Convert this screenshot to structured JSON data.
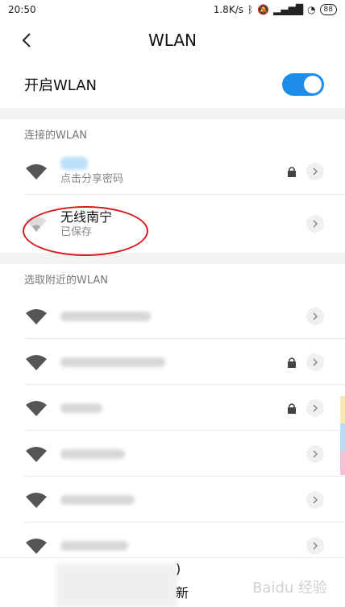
{
  "status": {
    "time": "20:50",
    "speed": "1.8K/s",
    "battery": "88"
  },
  "header": {
    "title": "WLAN"
  },
  "wlan_toggle": {
    "label": "开启WLAN",
    "enabled": true
  },
  "connected_section": {
    "title": "连接的WLAN"
  },
  "connected_networks": [
    {
      "name": "",
      "sub": "点击分享密码",
      "locked": true
    },
    {
      "name": "无线南宁",
      "sub": "已保存",
      "locked": false
    }
  ],
  "nearby_section": {
    "title": "选取附近的WLAN"
  },
  "nearby_networks": [
    {
      "name": "",
      "sub": "",
      "locked": false
    },
    {
      "name": "",
      "sub": "",
      "locked": true
    },
    {
      "name": "",
      "sub": "",
      "locked": true
    },
    {
      "name": "",
      "sub": "",
      "locked": false
    },
    {
      "name": "",
      "sub": "",
      "locked": false
    },
    {
      "name": "",
      "sub": "",
      "locked": false
    }
  ],
  "footer": {
    "partial_text": ")",
    "partial_text2": "新"
  },
  "watermark": "Baidu 经验"
}
